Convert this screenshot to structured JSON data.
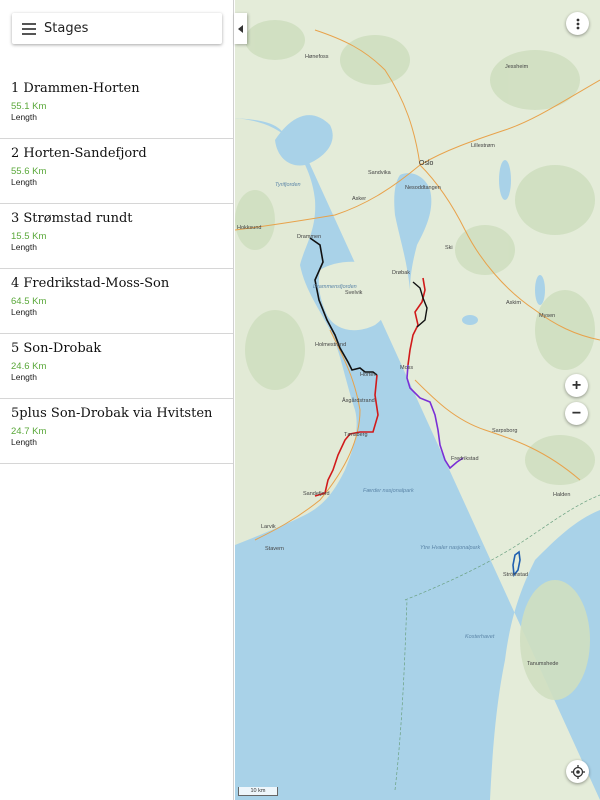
{
  "header": {
    "title": "Stages"
  },
  "stages": [
    {
      "name": "1 Drammen-Horten",
      "distance": "55.1 Km",
      "length_label": "Length"
    },
    {
      "name": "2 Horten-Sandefjord",
      "distance": "55.6 Km",
      "length_label": "Length"
    },
    {
      "name": "3 Strømstad rundt",
      "distance": "15.5 Km",
      "length_label": "Length"
    },
    {
      "name": "4 Fredrikstad-Moss-Son",
      "distance": "64.5 Km",
      "length_label": "Length"
    },
    {
      "name": "5 Son-Drobak",
      "distance": "24.6 Km",
      "length_label": "Length"
    },
    {
      "name": "5plus Son-Drobak via Hvitsten",
      "distance": "24.7 Km",
      "length_label": "Length"
    }
  ],
  "map": {
    "places": {
      "honefoss": "Hønefoss",
      "jessheim": "Jessheim",
      "lillestrom": "Lillestrøm",
      "oslo": "Oslo",
      "sandvika": "Sandvika",
      "asker": "Asker",
      "nesoddtangen": "Nesoddtangen",
      "hokksund": "Hokksund",
      "drammen": "Drammen",
      "ski": "Ski",
      "drobak": "Drøbak",
      "svelvik": "Svelvik",
      "askim": "Askim",
      "mysen": "Mysen",
      "holmestrand": "Holmestrand",
      "moss": "Moss",
      "horten": "Horten",
      "asgardstrand": "Åsgårdstrand",
      "tonsberg": "Tønsberg",
      "sarpsborg": "Sarpsborg",
      "fredrikstad": "Fredrikstad",
      "sandefjord": "Sandefjord",
      "halden": "Halden",
      "larvik": "Larvik",
      "stavern": "Stavern",
      "stromstad": "Strömstad",
      "tanumshede": "Tanumshede",
      "tyrifjorden": "Tyrifjorden",
      "drammensfjorden": "Drammensfjorden",
      "faerder": "Færder nasjonalpark",
      "ytre_hvaler": "Ytre Hvaler nasjonalpark",
      "kosterhavet": "Kosterhavet"
    },
    "scale_label": "10 km",
    "colors": {
      "route_black": "#111111",
      "route_red": "#d11a1a",
      "route_purple": "#7a2fd6",
      "route_blue": "#1f5fb0",
      "water": "#a9d2e8",
      "land": "#e4ecd9"
    },
    "icons": [
      "more-vert-icon",
      "zoom-in-icon",
      "zoom-out-icon",
      "locate-icon",
      "menu-icon",
      "collapse-arrow-icon"
    ]
  },
  "controls": {
    "zoom_in": "+",
    "zoom_out": "−"
  }
}
